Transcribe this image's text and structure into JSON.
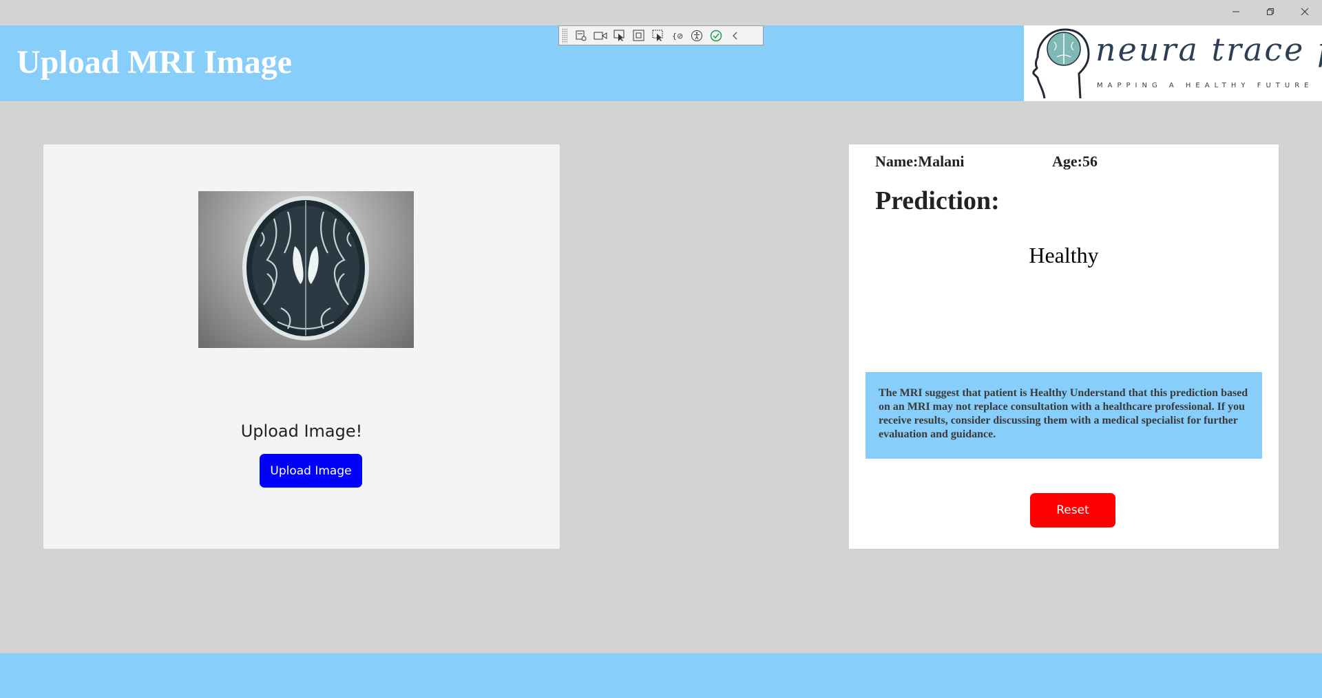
{
  "window": {
    "minimize_icon": "minimize-icon",
    "maximize_icon": "restore-icon",
    "close_icon": "close-icon"
  },
  "header": {
    "title": "Upload MRI Image",
    "background_color": "#87cefa"
  },
  "logo": {
    "name": "neura trace pd",
    "tagline": "MAPPING A HEALTHY FUTURE"
  },
  "devtools_toolbar": {
    "icons": [
      "live-visual-tree-icon",
      "record-icon",
      "select-element-icon",
      "display-layout-adorners-icon",
      "track-focus-icon",
      "binding-failures-icon",
      "accessibility-checker-icon",
      "checkmark-icon",
      "collapse-icon"
    ]
  },
  "upload_panel": {
    "prompt": "Upload Image!",
    "button_label": "Upload Image",
    "button_color": "#0000ff"
  },
  "result_panel": {
    "name_text": "Name:Malani",
    "age_text": "Age:56",
    "prediction_label": "Prediction:",
    "prediction_value": "Healthy",
    "advice": "The MRI suggest that patient is Healthy Understand that this prediction based on an MRI may not replace consultation with a healthcare professional. If you receive results, consider discussing them with a medical specialist for further evaluation and guidance.",
    "reset_label": "Reset",
    "reset_color": "#ff0000"
  }
}
